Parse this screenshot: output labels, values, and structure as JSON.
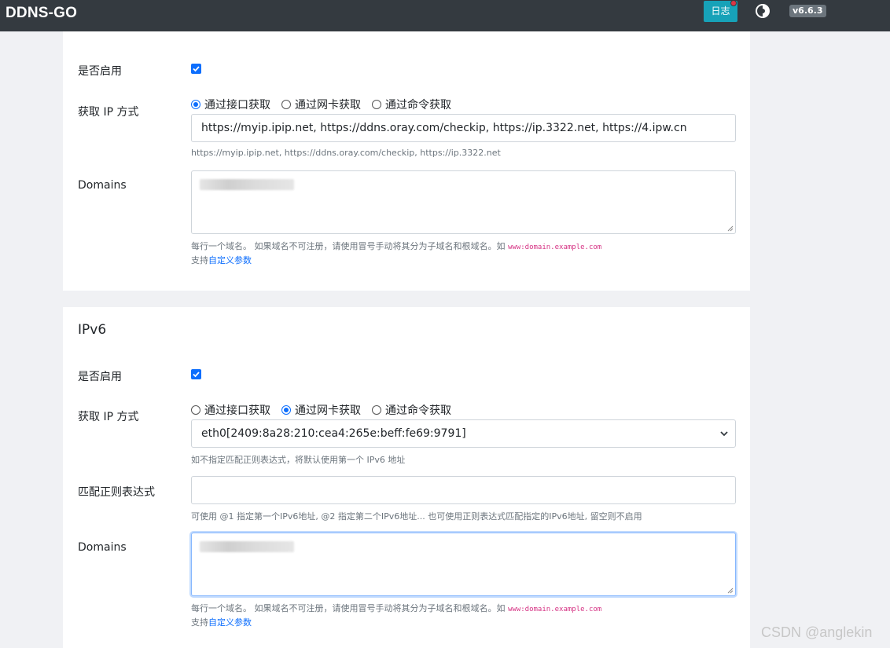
{
  "navbar": {
    "brand": "DDNS-GO",
    "log_button": "日志",
    "version": "v6.6.3",
    "icons": [
      "theme-toggle-icon"
    ]
  },
  "ipv4": {
    "enabled_label": "是否启用",
    "enabled": true,
    "get_ip_label": "获取 IP 方式",
    "options": [
      "通过接口获取",
      "通过网卡获取",
      "通过命令获取"
    ],
    "selected_option": "通过接口获取",
    "url_value": "https://myip.ipip.net, https://ddns.oray.com/checkip, https://ip.3322.net, https://4.ipw.cn",
    "url_help": "https://myip.ipip.net, https://ddns.oray.com/checkip, https://ip.3322.net",
    "domains_label": "Domains",
    "domains_help": "每行一个域名。 如果域名不可注册，请使用冒号手动将其分为子域名和根域名。如",
    "domains_example": "www:domain.example.com",
    "support_prefix": "支持",
    "custom_params_link": "自定义参数"
  },
  "ipv6": {
    "title": "IPv6",
    "enabled_label": "是否启用",
    "enabled": true,
    "get_ip_label": "获取 IP 方式",
    "options": [
      "通过接口获取",
      "通过网卡获取",
      "通过命令获取"
    ],
    "selected_option": "通过网卡获取",
    "interface_value": "eth0[2409:8a28:210:cea4:265e:beff:fe69:9791]",
    "interface_help": "如不指定匹配正则表达式，将默认使用第一个 IPv6 地址",
    "regex_label": "匹配正则表达式",
    "regex_value": "",
    "regex_help": "可使用 @1 指定第一个IPv6地址, @2 指定第二个IPv6地址... 也可使用正则表达式匹配指定的IPv6地址, 留空则不启用",
    "domains_label": "Domains",
    "domains_help": "每行一个域名。 如果域名不可注册，请使用冒号手动将其分为子域名和根域名。如",
    "domains_example": "www:domain.example.com",
    "support_prefix": "支持",
    "custom_params_link": "自定义参数"
  },
  "watermark": "CSDN @anglekin",
  "colors": {
    "navbar": "#343a40",
    "accent": "#0d6efd",
    "log_button": "#17a2b8",
    "badge": "#6c757d"
  }
}
